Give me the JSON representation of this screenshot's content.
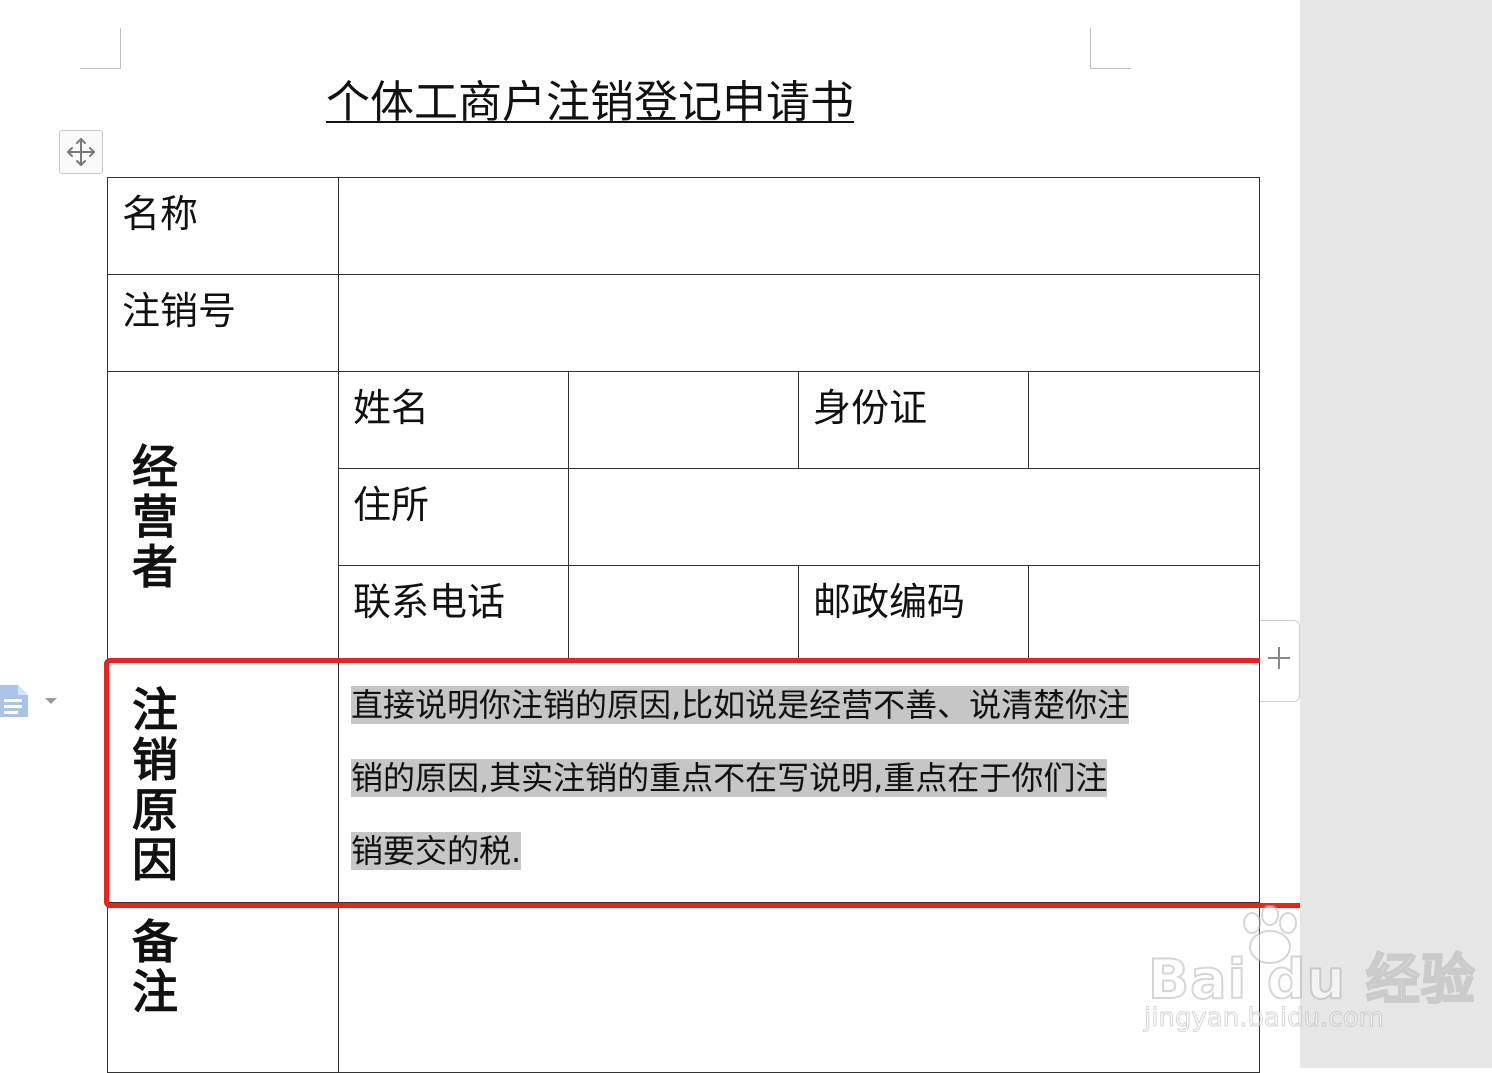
{
  "document": {
    "title": "个体工商户注销登记申请书"
  },
  "form": {
    "name_label": "名称",
    "reg_no_label": "注销号",
    "operator": {
      "section": [
        "经",
        "营",
        "者"
      ],
      "name_label": "姓名",
      "id_label": "身份证",
      "address_label": "住所",
      "phone_label": "联系电话",
      "postcode_label": "邮政编码"
    },
    "reason": {
      "section": [
        "注",
        "销",
        "原",
        "因"
      ],
      "lines": [
        "直接说明你注销的原因,比如说是经营不善、说清楚你注",
        "销的原因,其实注销的重点不在写说明,重点在于你们注",
        "销要交的税."
      ]
    },
    "remarks": {
      "section": [
        "备",
        "注"
      ]
    }
  },
  "icons": {
    "table_move": "four-way-arrow-icon",
    "side_document": "document-icon",
    "add_column": "plus-icon"
  },
  "colors": {
    "highlight_box": "#e8231e",
    "text_selection": "#c6c6c6",
    "gutter": "#e6e6e6"
  },
  "watermark": {
    "brand": "Bai du 经验",
    "url": "jingyan.baidu.com"
  }
}
